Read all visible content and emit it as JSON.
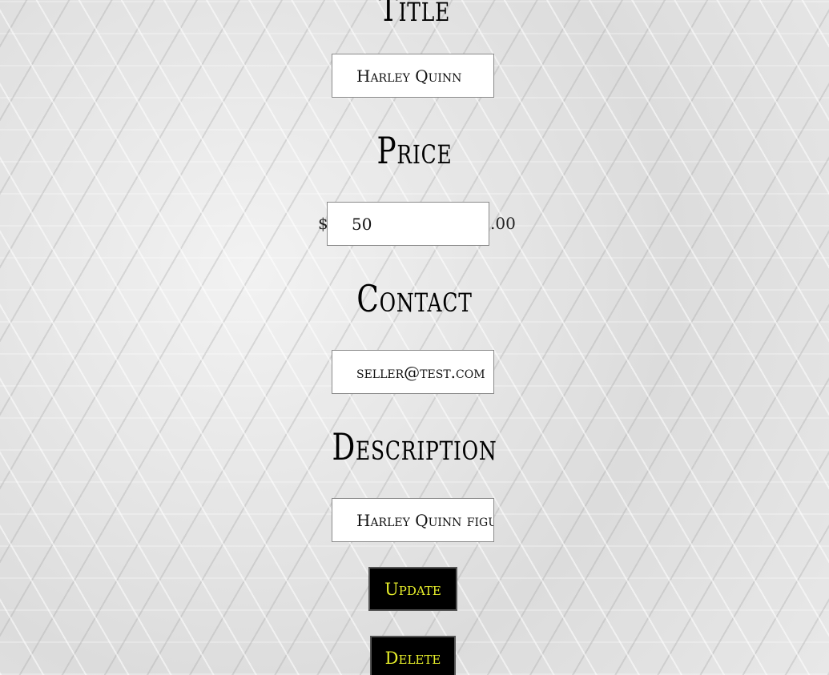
{
  "form": {
    "title": {
      "label": "Title",
      "value": "Harley Quinn"
    },
    "price": {
      "label": "Price",
      "prefix": "$",
      "value": "50",
      "suffix": ".00"
    },
    "contact": {
      "label": "Contact",
      "value": "seller@test.com"
    },
    "description": {
      "label": "Description",
      "value": "Harley Quinn figur"
    },
    "update_label": "Update",
    "delete_label": "Delete"
  },
  "colors": {
    "button_bg": "#000000",
    "button_text": "#e7ef2a"
  }
}
